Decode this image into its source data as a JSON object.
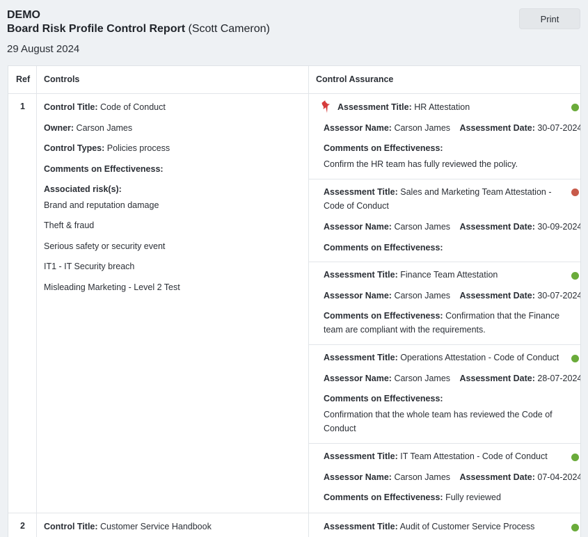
{
  "header": {
    "org": "DEMO",
    "report_title": "Board Risk Profile Control Report",
    "report_owner": "(Scott Cameron)",
    "date": "29 August 2024",
    "print_label": "Print"
  },
  "table": {
    "columns": {
      "ref": "Ref",
      "controls": "Controls",
      "assurance": "Control Assurance"
    }
  },
  "labels": {
    "control_title": "Control Title:",
    "owner": "Owner:",
    "control_types": "Control Types:",
    "comments": "Comments on Effectiveness:",
    "associated_risks": "Associated risk(s):",
    "assessment_title": "Assessment Title:",
    "assessor_name": "Assessor Name:",
    "assessment_date": "Assessment Date:"
  },
  "colors": {
    "status_green": "#6aab3a",
    "status_red": "#c85a4a",
    "pin_red": "#d63b3b"
  },
  "rows": [
    {
      "ref": "1",
      "control_title": "Code of Conduct",
      "owner": "Carson James",
      "control_types": "Policies process",
      "risks": [
        "Brand and reputation damage",
        "Theft & fraud",
        "Serious safety or security event",
        "IT1 - IT Security breach",
        "Misleading Marketing - Level 2 Test"
      ],
      "assessments": [
        {
          "title": "HR Attestation",
          "assessor": "Carson James",
          "date": "30-07-2024",
          "comment": "Confirm the HR team has fully reviewed the policy.",
          "status": "green",
          "pinned": true,
          "pin_icon": "pushpin-icon"
        },
        {
          "title": "Sales and Marketing Team Attestation - Code of Conduct",
          "assessor": "Carson James",
          "date": "30-09-2024",
          "comment": "",
          "status": "red"
        },
        {
          "title": "Finance Team Attestation",
          "assessor": "Carson James",
          "date": "30-07-2024",
          "comment": "Confirmation that the Finance team are compliant with the requirements.",
          "status": "green"
        },
        {
          "title": "Operations Attestation - Code of Conduct",
          "assessor": "Carson James",
          "date": "28-07-2024",
          "comment": "Confirmation that the whole team has reviewed the Code of Conduct",
          "status": "green"
        },
        {
          "title": "IT Team Attestation - Code of Conduct",
          "assessor": "Carson James",
          "date": "07-04-2024",
          "comment": "Fully reviewed",
          "status": "green"
        }
      ]
    },
    {
      "ref": "2",
      "control_title": "Customer Service Handbook",
      "assessments": [
        {
          "title": "Audit of Customer Service Process",
          "status": "green"
        }
      ]
    }
  ]
}
